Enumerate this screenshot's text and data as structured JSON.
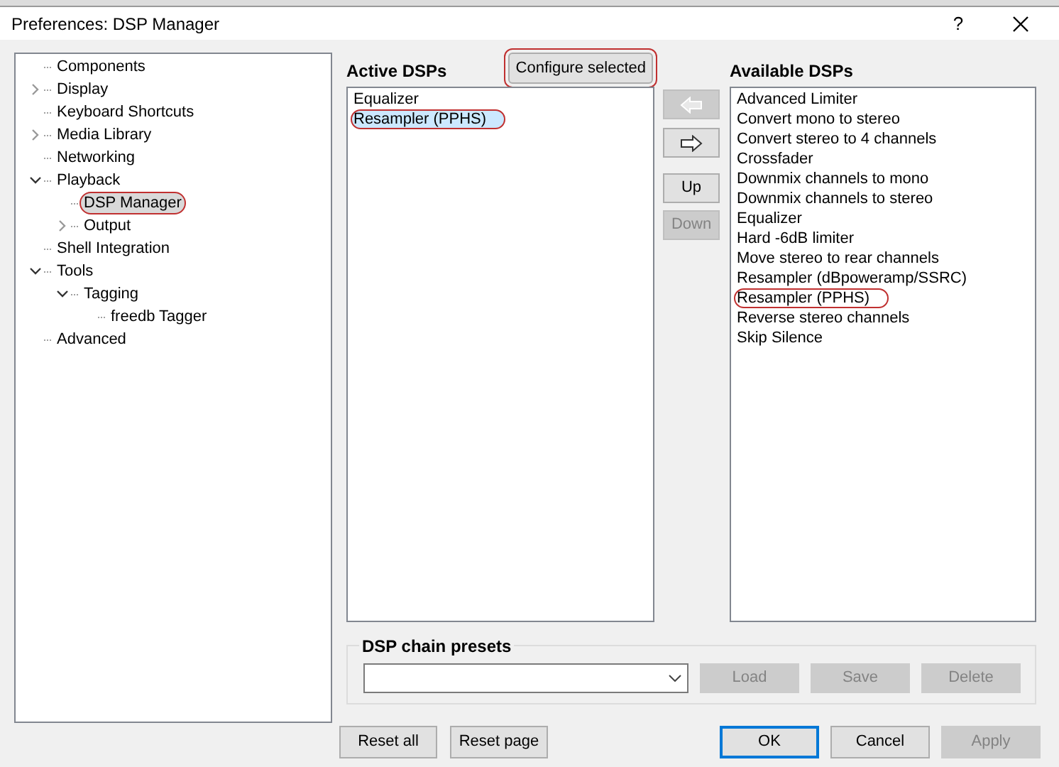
{
  "window": {
    "title": "Preferences: DSP Manager",
    "help": "?"
  },
  "tree": [
    {
      "label": "Components",
      "selected": false,
      "annotated": false
    },
    {
      "label": "Display",
      "expanded": false,
      "selected": false,
      "annotated": false
    },
    {
      "label": "Keyboard Shortcuts",
      "selected": false,
      "annotated": false
    },
    {
      "label": "Media Library",
      "expanded": false,
      "selected": false,
      "annotated": false
    },
    {
      "label": "Networking",
      "selected": false,
      "annotated": false
    },
    {
      "label": "Playback",
      "expanded": true,
      "selected": false,
      "annotated": false,
      "children": [
        {
          "label": "DSP Manager",
          "selected": true,
          "annotated": true
        },
        {
          "label": "Output",
          "expanded": false,
          "selected": false,
          "annotated": false
        }
      ]
    },
    {
      "label": "Shell Integration",
      "selected": false,
      "annotated": false
    },
    {
      "label": "Tools",
      "expanded": true,
      "selected": false,
      "annotated": false,
      "children": [
        {
          "label": "Tagging",
          "expanded": true,
          "selected": false,
          "annotated": false,
          "children": [
            {
              "label": "freedb Tagger",
              "selected": false,
              "annotated": false
            }
          ]
        }
      ]
    },
    {
      "label": "Advanced",
      "selected": false,
      "annotated": false
    }
  ],
  "active": {
    "heading": "Active DSPs",
    "configure": {
      "label": "Configure selected",
      "annotated": true
    },
    "items": [
      {
        "label": "Equalizer",
        "selected": false,
        "annotated": false
      },
      {
        "label": "Resampler (PPHS)",
        "selected": true,
        "annotated": true
      }
    ]
  },
  "move_buttons": [
    {
      "kind": "arrow-left",
      "disabled": true
    },
    {
      "kind": "arrow-right",
      "disabled": false
    },
    {
      "kind": "text",
      "label": "Up",
      "disabled": false
    },
    {
      "kind": "text",
      "label": "Down",
      "disabled": true
    }
  ],
  "available": {
    "heading": "Available DSPs",
    "items": [
      {
        "label": "Advanced Limiter",
        "selected": false,
        "annotated": false
      },
      {
        "label": "Convert mono to stereo",
        "selected": false,
        "annotated": false
      },
      {
        "label": "Convert stereo to 4 channels",
        "selected": false,
        "annotated": false
      },
      {
        "label": "Crossfader",
        "selected": false,
        "annotated": false
      },
      {
        "label": "Downmix channels to mono",
        "selected": false,
        "annotated": false
      },
      {
        "label": "Downmix channels to stereo",
        "selected": false,
        "annotated": false
      },
      {
        "label": "Equalizer",
        "selected": false,
        "annotated": false
      },
      {
        "label": "Hard -6dB limiter",
        "selected": false,
        "annotated": false
      },
      {
        "label": "Move stereo to rear channels",
        "selected": false,
        "annotated": false
      },
      {
        "label": "Resampler (dBpoweramp/SSRC)",
        "selected": false,
        "annotated": false
      },
      {
        "label": "Resampler (PPHS)",
        "selected": false,
        "annotated": true
      },
      {
        "label": "Reverse stereo channels",
        "selected": false,
        "annotated": false
      },
      {
        "label": "Skip Silence",
        "selected": false,
        "annotated": false
      }
    ]
  },
  "presets": {
    "heading": "DSP chain presets",
    "buttons": [
      {
        "label": "Load",
        "disabled": true
      },
      {
        "label": "Save",
        "disabled": true
      },
      {
        "label": "Delete",
        "disabled": true
      }
    ]
  },
  "footer_left": [
    {
      "label": "Reset all",
      "disabled": false,
      "default": false
    },
    {
      "label": "Reset page",
      "disabled": false,
      "default": false
    }
  ],
  "footer_right": [
    {
      "label": "OK",
      "disabled": false,
      "default": true
    },
    {
      "label": "Cancel",
      "disabled": false,
      "default": false
    },
    {
      "label": "Apply",
      "disabled": true,
      "default": false
    }
  ]
}
